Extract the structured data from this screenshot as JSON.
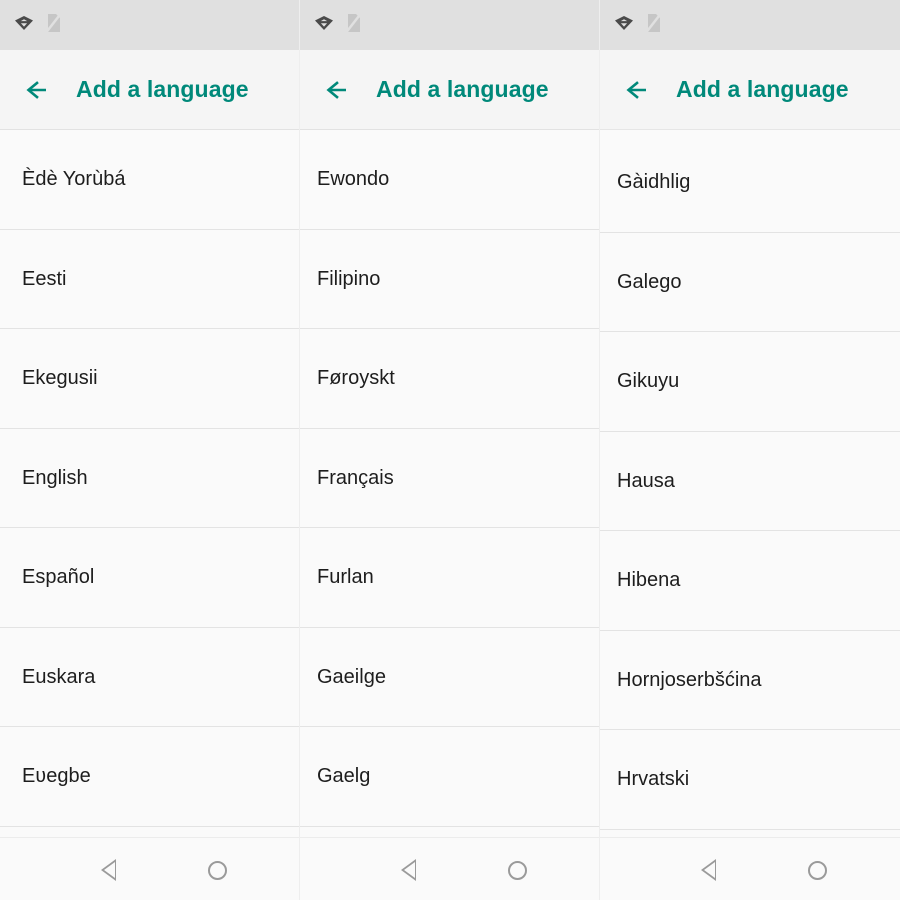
{
  "panels": [
    {
      "statusbar": {
        "icons": [
          "wifi-icon",
          "sim-off-icon"
        ]
      },
      "appbar": {
        "back_label": "←",
        "title": "Add a language"
      },
      "languages": [
        "Èdè Yorùbá",
        "Eesti",
        "Ekegusii",
        "English",
        "Español",
        "Euskara",
        "Eʋegbe"
      ],
      "navbar": {
        "back": "back-triangle",
        "home": "home-circle"
      }
    },
    {
      "statusbar": {
        "icons": [
          "wifi-icon",
          "sim-off-icon"
        ]
      },
      "appbar": {
        "back_label": "←",
        "title": "Add a language"
      },
      "languages": [
        "Ewondo",
        "Filipino",
        "Føroyskt",
        "Français",
        "Furlan",
        "Gaeilge",
        "Gaelg"
      ],
      "navbar": {
        "back": "back-triangle",
        "home": "home-circle"
      }
    },
    {
      "statusbar": {
        "icons": [
          "wifi-icon",
          "sim-off-icon"
        ]
      },
      "appbar": {
        "back_label": "←",
        "title": "Add a language"
      },
      "languages": [
        "Gàidhlig",
        "Galego",
        "Gikuyu",
        "Hausa",
        "Hibena",
        "Hornjoserbšćina",
        "Hrvatski"
      ],
      "navbar": {
        "back": "back-triangle",
        "home": "home-circle"
      }
    }
  ],
  "colors": {
    "accent": "#00897a",
    "statusbar_bg": "#e0e0e0",
    "appbar_bg": "#f5f5f5",
    "list_bg": "#fafafa",
    "divider": "#e3e3e3",
    "row_text": "#1d1d1d",
    "nav_icon": "#9a9a9a"
  }
}
